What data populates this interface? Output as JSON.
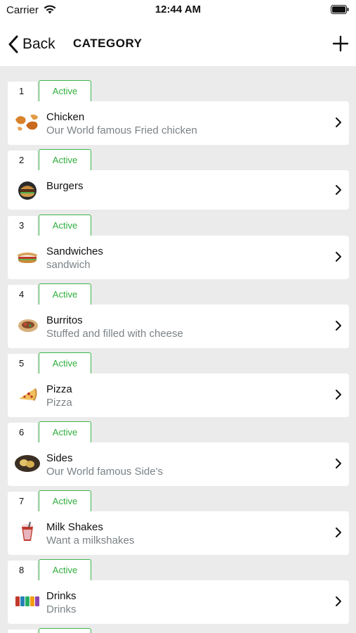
{
  "status": {
    "carrier": "Carrier",
    "time": "12:44 AM"
  },
  "nav": {
    "back_label": "Back",
    "title": "CATEGORY"
  },
  "items": [
    {
      "num": "1",
      "status": "Active",
      "name": "Chicken",
      "desc": "Our World famous Fried chicken",
      "icon": "chicken-icon"
    },
    {
      "num": "2",
      "status": "Active",
      "name": "Burgers",
      "desc": "",
      "icon": "burger-icon"
    },
    {
      "num": "3",
      "status": "Active",
      "name": "Sandwiches",
      "desc": "sandwich",
      "icon": "sandwich-icon"
    },
    {
      "num": "4",
      "status": "Active",
      "name": "Burritos",
      "desc": "Stuffed and filled with cheese",
      "icon": "burrito-icon"
    },
    {
      "num": "5",
      "status": "Active",
      "name": "Pizza",
      "desc": "Pizza",
      "icon": "pizza-icon"
    },
    {
      "num": "6",
      "status": "Active",
      "name": "Sides",
      "desc": "Our World famous Side's",
      "icon": "sides-icon"
    },
    {
      "num": "7",
      "status": "Active",
      "name": "Milk Shakes",
      "desc": "Want a milkshakes",
      "icon": "milkshake-icon"
    },
    {
      "num": "8",
      "status": "Active",
      "name": "Drinks",
      "desc": "Drinks",
      "icon": "drinks-icon"
    }
  ],
  "colors": {
    "accent": "#2fae3c",
    "subtitle": "#7b8287",
    "background": "#ebebeb"
  }
}
